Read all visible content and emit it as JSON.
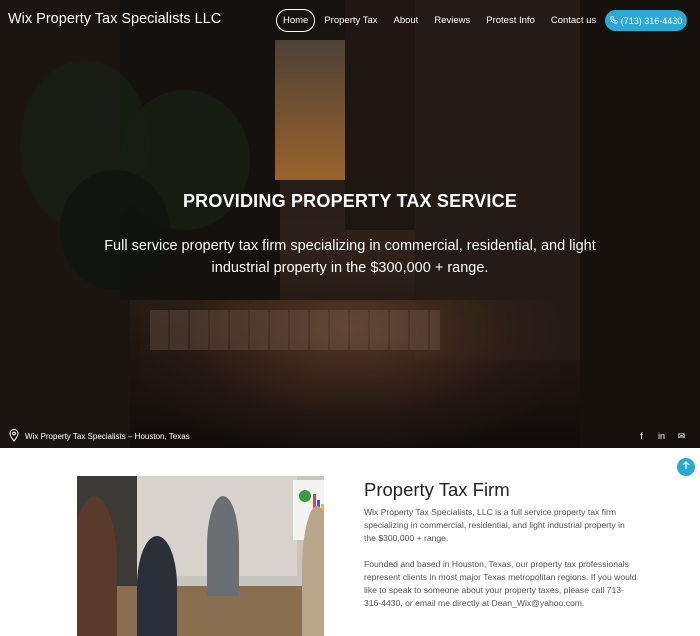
{
  "header": {
    "brand": "Wix Property Tax Specialists LLC",
    "nav": [
      {
        "label": "Home",
        "active": true
      },
      {
        "label": "Property Tax",
        "active": false
      },
      {
        "label": "About",
        "active": false
      },
      {
        "label": "Reviews",
        "active": false
      },
      {
        "label": "Protest Info",
        "active": false
      },
      {
        "label": "Contact us",
        "active": false
      }
    ],
    "phone": "(713) 316-4430",
    "phone_icon": "phone-icon"
  },
  "hero": {
    "title": "PROVIDING PROPERTY TAX SERVICE",
    "subtitle": "Full service property tax firm specializing in commercial, residential, and light industrial property in the $300,000 + range.",
    "location": "Wix Property Tax Specialists – Houston, Texas",
    "location_icon": "map-pin-icon",
    "socials": [
      {
        "icon": "facebook-icon",
        "glyph": "f"
      },
      {
        "icon": "linkedin-icon",
        "glyph": "in"
      },
      {
        "icon": "email-icon",
        "glyph": "✉"
      }
    ]
  },
  "section": {
    "title": "Property Tax Firm",
    "paragraph1": "Wix Property Tax Specialists, LLC is a full service property tax firm specializing in commercial, residential, and light industrial property in the $300,000 + range.",
    "paragraph2": "Founded and based in Houston, Texas, our property tax professionals represent clients in most major Texas metropolitan regions. If you would like to speak to someone about your property taxes, please call 713-316-4430, or email me directly at Dean_Wix@yahoo.com.",
    "scroll_top_icon": "arrow-up-icon"
  },
  "colors": {
    "accent": "#2aa8d6",
    "text_dark": "#222222",
    "text_body": "#555555"
  }
}
